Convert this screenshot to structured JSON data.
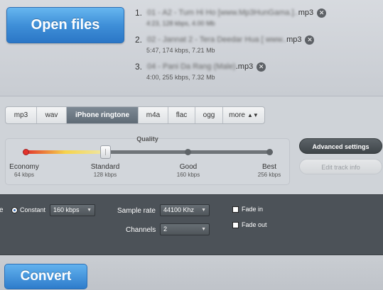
{
  "open_button": "Open files",
  "files": [
    {
      "num": "1.",
      "name_blurred": "01 - A2 - Tum Hi Ho [www.Mp3HunGama.]..",
      "ext": "mp3",
      "meta": "4:23, 128 kbps, 4.00 Mb"
    },
    {
      "num": "2.",
      "name_blurred": "02 - Jannat 2 - Tera Deedar Hua [ www..",
      "ext": "mp3",
      "meta": "5:47, 174 kbps, 7.21 Mb"
    },
    {
      "num": "3.",
      "name_blurred": "04 - Pani Da Rang (Male)",
      "ext": ".mp3",
      "meta": "4:00, 255 kbps, 7.32 Mb"
    }
  ],
  "remove_icon_glyph": "✕",
  "formats": [
    {
      "label": "mp3",
      "active": false
    },
    {
      "label": "wav",
      "active": false
    },
    {
      "label": "iPhone ringtone",
      "active": true
    },
    {
      "label": "m4a",
      "active": false
    },
    {
      "label": "flac",
      "active": false
    },
    {
      "label": "ogg",
      "active": false
    },
    {
      "label": "more",
      "active": false
    }
  ],
  "more_chevron_glyph": "▲▼",
  "quality": {
    "title": "Quality",
    "selected_level": 1,
    "levels": [
      {
        "label": "Economy",
        "sub": "64 kbps"
      },
      {
        "label": "Standard",
        "sub": "128 kbps"
      },
      {
        "label": "Good",
        "sub": "160 kbps"
      },
      {
        "label": "Best",
        "sub": "256 kbps"
      }
    ]
  },
  "advanced_button": "Advanced settings",
  "edit_button": "Edit track info",
  "advanced": {
    "mode_fragment": "e",
    "mode_label": "Constant",
    "bitrate": "160 kbps",
    "sample_rate_label": "Sample rate",
    "sample_rate": "44100 Khz",
    "channels_label": "Channels",
    "channels": "2",
    "fade_in": "Fade in",
    "fade_out": "Fade out",
    "select_arrow_glyph": "▼"
  },
  "convert_button": "Convert",
  "colors": {
    "accent_blue": "#3f8fd8",
    "panel_dark": "#4c5258",
    "tab_active": "#6a7681"
  }
}
